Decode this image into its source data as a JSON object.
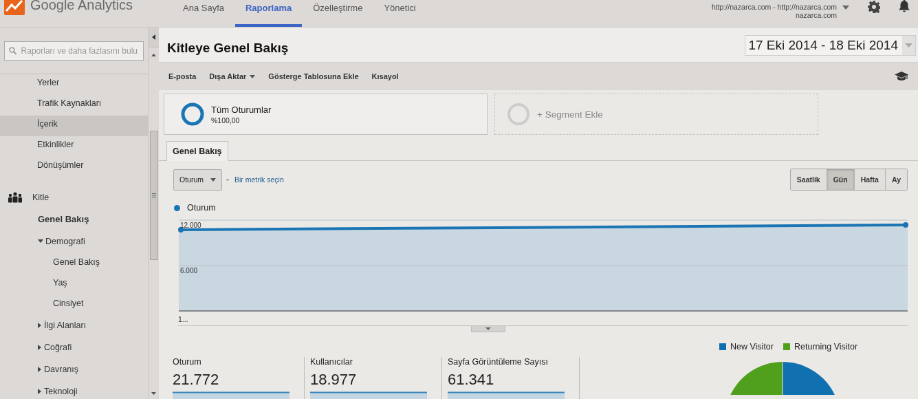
{
  "header": {
    "product": "Google Analytics",
    "tabs": [
      {
        "label": "Ana Sayfa",
        "selected": false
      },
      {
        "label": "Raporlama",
        "selected": true
      },
      {
        "label": "Özelleştirme",
        "selected": false
      },
      {
        "label": "Yönetici",
        "selected": false
      }
    ],
    "account": {
      "line_1": "http://nazarca.com - http://nazarca.com",
      "line_2": "nazarca.com"
    }
  },
  "sidebar": {
    "search": {
      "placeholder": "Raporları ve daha fazlasını bulu"
    },
    "items": [
      {
        "label": "Yerler",
        "highlighted": false
      },
      {
        "label": "Trafik Kaynakları",
        "highlighted": false
      },
      {
        "label": "İçerik",
        "highlighted": true
      },
      {
        "label": "Etkinlikler",
        "highlighted": false
      },
      {
        "label": "Dönüşümler",
        "highlighted": false
      }
    ],
    "section": {
      "label": "Kitle",
      "children": [
        {
          "label": "Genel Bakış",
          "selected": true
        },
        {
          "label": "Demografi",
          "selected": false,
          "expanded": true,
          "children": [
            {
              "label": "Genel Bakış",
              "selected": false
            },
            {
              "label": "Yaş",
              "selected": false
            },
            {
              "label": "Cinsiyet",
              "selected": false
            }
          ]
        },
        {
          "label": "İlgi Alanları",
          "selected": false,
          "expanded": false
        },
        {
          "label": "Coğrafi",
          "selected": false,
          "expanded": false
        },
        {
          "label": "Davranış",
          "selected": false,
          "expanded": false
        },
        {
          "label": "Teknoloji",
          "selected": false,
          "expanded": false
        }
      ]
    }
  },
  "page": {
    "title": "Kitleye Genel Bakış",
    "date_range": "17 Eki 2014 - 18 Eki 2014",
    "toolbar": [
      {
        "label": "E-posta",
        "dropdown": false
      },
      {
        "label": "Dışa Aktar",
        "dropdown": true
      },
      {
        "label": "Gösterge Tablosuna Ekle",
        "dropdown": false
      },
      {
        "label": "Kısayol",
        "dropdown": false
      }
    ],
    "segments": [
      {
        "kind": "segment",
        "label": "Tüm Oturumlar",
        "detail": "%100,00"
      },
      {
        "kind": "add",
        "label": "+ Segment Ekle"
      }
    ],
    "tabs": [
      {
        "label": "Genel Bakış",
        "selected": true
      }
    ],
    "metric_select": "Oturum",
    "separator": "-",
    "metric_link": "Bir metrik seçin",
    "periods": [
      {
        "label": "Saatlik",
        "selected": false
      },
      {
        "label": "Gün",
        "selected": true
      },
      {
        "label": "Hafta",
        "selected": false
      },
      {
        "label": "Ay",
        "selected": false
      }
    ],
    "chart": {
      "legend": {
        "label": "Oturum",
        "color": "#1a75b4"
      },
      "y_labels": [
        "12.000",
        "6.000"
      ],
      "x_label": "1..."
    },
    "metrics": [
      {
        "label": "Oturum",
        "value": "21.772"
      },
      {
        "label": "Kullanıcılar",
        "value": "18.977"
      },
      {
        "label": "Sayfa Görüntüleme Sayısı",
        "value": "61.341"
      }
    ],
    "pie_legend": [
      {
        "label": "New Visitor",
        "color": "#1070b0"
      },
      {
        "label": "Returning Visitor",
        "color": "#50a01e"
      }
    ]
  }
}
